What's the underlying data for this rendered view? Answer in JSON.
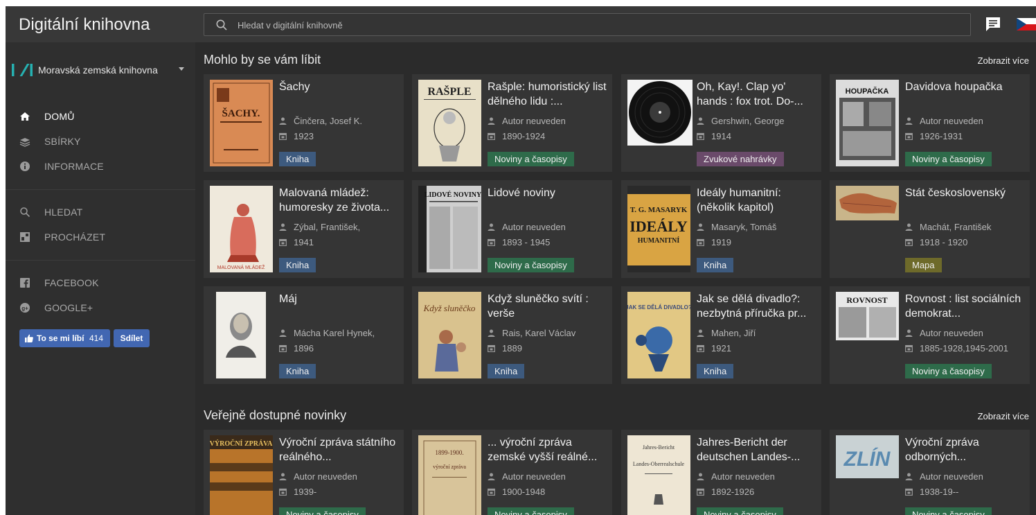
{
  "app": {
    "title": "Digitální knihovna"
  },
  "search": {
    "placeholder": "Hledat v digitální knihovně"
  },
  "colors": {
    "badge_book": "#3d5a7e",
    "badge_periodical": "#2e6b4a",
    "badge_sound": "#6a4a6a",
    "badge_map": "#6e6a2a",
    "accent": "#26b1b1"
  },
  "sidebar": {
    "library": "Moravská zemská knihovna",
    "nav": [
      {
        "label": "DOMŮ",
        "icon": "home-icon"
      },
      {
        "label": "SBÍRKY",
        "icon": "collections-icon"
      },
      {
        "label": "INFORMACE",
        "icon": "info-icon"
      },
      {
        "label": "HLEDAT",
        "icon": "search-icon"
      },
      {
        "label": "PROCHÁZET",
        "icon": "browse-icon"
      },
      {
        "label": "FACEBOOK",
        "icon": "facebook-icon"
      },
      {
        "label": "GOOGLE+",
        "icon": "google-plus-icon"
      }
    ],
    "fb_like_label": "To se mi líbí",
    "fb_like_count": "414",
    "fb_share_label": "Sdílet"
  },
  "sections": [
    {
      "title": "Mohlo by se vám líbit",
      "more": "Zobrazit více",
      "cards": [
        {
          "title": "Šachy",
          "author": "Činčera, Josef K.",
          "year": "1923",
          "type": "Kniha"
        },
        {
          "title": "Rašple: humoristický list dělného lidu :...",
          "author": "Autor neuveden",
          "year": "1890-1924",
          "type": "Noviny a časopisy"
        },
        {
          "title": "Oh, Kay!. Clap yo' hands : fox trot. Do-...",
          "author": "Gershwin, George",
          "year": "1914",
          "type": "Zvukové nahrávky"
        },
        {
          "title": "Davidova houpačka",
          "author": "Autor neuveden",
          "year": "1926-1931",
          "type": "Noviny a časopisy"
        },
        {
          "title": "Malovaná mládež: humoresky ze života...",
          "author": "Zýbal, František,",
          "year": "1941",
          "type": "Kniha"
        },
        {
          "title": "Lidové noviny",
          "author": "Autor neuveden",
          "year": "1893 - 1945",
          "type": "Noviny a časopisy"
        },
        {
          "title": "Ideály humanitní: (několik kapitol)",
          "author": "Masaryk, Tomáš",
          "year": "1919",
          "type": "Kniha"
        },
        {
          "title": "Stát československý",
          "author": "Machát, František",
          "year": "1918 - 1920",
          "type": "Mapa"
        },
        {
          "title": "Máj",
          "author": "Mácha Karel Hynek,",
          "year": "1896",
          "type": "Kniha"
        },
        {
          "title": "Když sluněčko svítí : verše",
          "author": "Rais, Karel Václav",
          "year": "1889",
          "type": "Kniha"
        },
        {
          "title": "Jak se dělá divadlo?: nezbytná příručka pr...",
          "author": "Mahen, Jiří",
          "year": "1921",
          "type": "Kniha"
        },
        {
          "title": "Rovnost : list sociálních demokrat...",
          "author": "Autor neuveden",
          "year": "1885-1928,1945-2001",
          "type": "Noviny a časopisy"
        }
      ]
    },
    {
      "title": "Veřejně dostupné novinky",
      "more": "Zobrazit více",
      "cards": [
        {
          "title": "Výroční zpráva státního reálného...",
          "author": "Autor neuveden",
          "year": "1939-",
          "type": "Noviny a časopisy"
        },
        {
          "title": "... výroční zpráva zemské vyšší reálné...",
          "author": "Autor neuveden",
          "year": "1900-1948",
          "type": "Noviny a časopisy"
        },
        {
          "title": "Jahres-Bericht der deutschen Landes-...",
          "author": "Autor neuveden",
          "year": "1892-1926",
          "type": "Noviny a časopisy"
        },
        {
          "title": "Výroční zpráva odborných...",
          "author": "Autor neuveden",
          "year": "1938-19--",
          "type": "Noviny a časopisy"
        }
      ]
    }
  ]
}
